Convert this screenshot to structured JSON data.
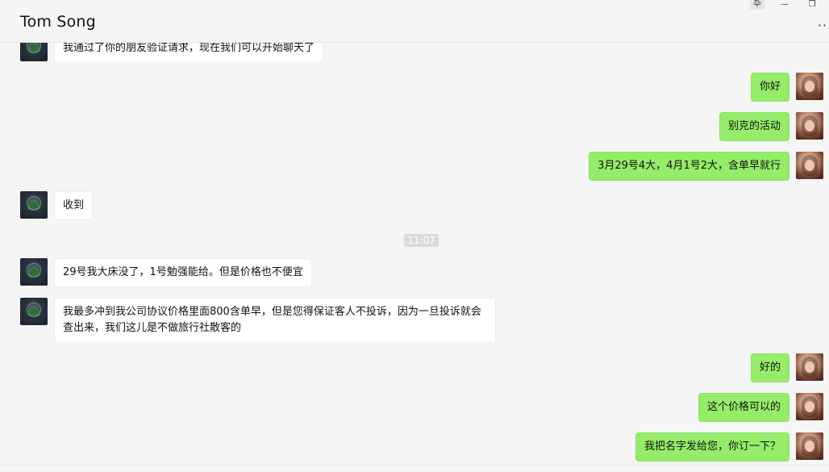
{
  "window": {
    "title": "Tom Song",
    "controls": {
      "pin": "卆",
      "minimize": "—",
      "restore": "❐"
    },
    "more": "··"
  },
  "chat": {
    "time_divider": "11:07",
    "messages": [
      {
        "side": "left",
        "text": "我通过了你的朋友验证请求，现在我们可以开始聊天了"
      },
      {
        "side": "right",
        "text": "你好"
      },
      {
        "side": "right",
        "text": "别克的活动"
      },
      {
        "side": "right",
        "text": "3月29号4大，4月1号2大，含单早就行"
      },
      {
        "side": "left",
        "text": "收到"
      },
      {
        "side": "left",
        "text": "29号我大床没了，1号勉强能给。但是价格也不便宜"
      },
      {
        "side": "left",
        "text": "我最多冲到我公司协议价格里面800含单早，但是您得保证客人不投诉，因为一旦投诉就会查出来，我们这儿是不做旅行社散客的"
      },
      {
        "side": "right",
        "text": "好的"
      },
      {
        "side": "right",
        "text": "这个价格可以的"
      },
      {
        "side": "right",
        "text": "我把名字发给您，你订一下？"
      }
    ]
  }
}
